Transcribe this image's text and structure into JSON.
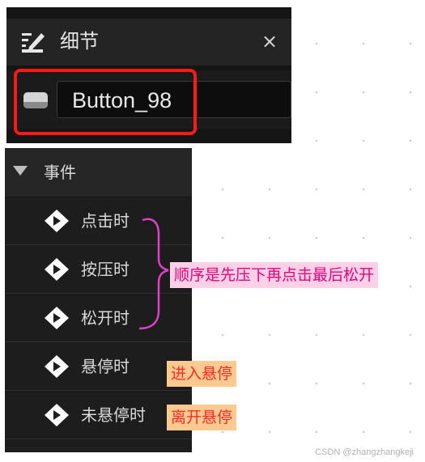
{
  "details": {
    "title": "细节",
    "close_glyph": "×",
    "widget_name": "Button_98",
    "icons": {
      "header": "edit-details-icon",
      "widget": "button-widget-icon",
      "close": "close-icon"
    }
  },
  "events": {
    "section_title": "事件",
    "items": [
      {
        "label": "点击时",
        "icon": "event-diamond-icon"
      },
      {
        "label": "按压时",
        "icon": "event-diamond-icon"
      },
      {
        "label": "松开时",
        "icon": "event-diamond-icon"
      },
      {
        "label": "悬停时",
        "icon": "event-diamond-icon"
      },
      {
        "label": "未悬停时",
        "icon": "event-diamond-icon"
      }
    ]
  },
  "annotations": {
    "order_note": "顺序是先压下再点击最后松开",
    "hover_note": "进入悬停",
    "unhover_note": "离开悬停"
  },
  "colors": {
    "highlight_box": "#ff1a1a",
    "order_note_bg": "#ffd0e6",
    "order_note_text": "#e6007a",
    "hover_note_bg": "#ffc98f",
    "hover_note_text": "#ff2a2a",
    "bracket": "#e040c8"
  },
  "watermark": "CSDN @zhangzhangkeji"
}
